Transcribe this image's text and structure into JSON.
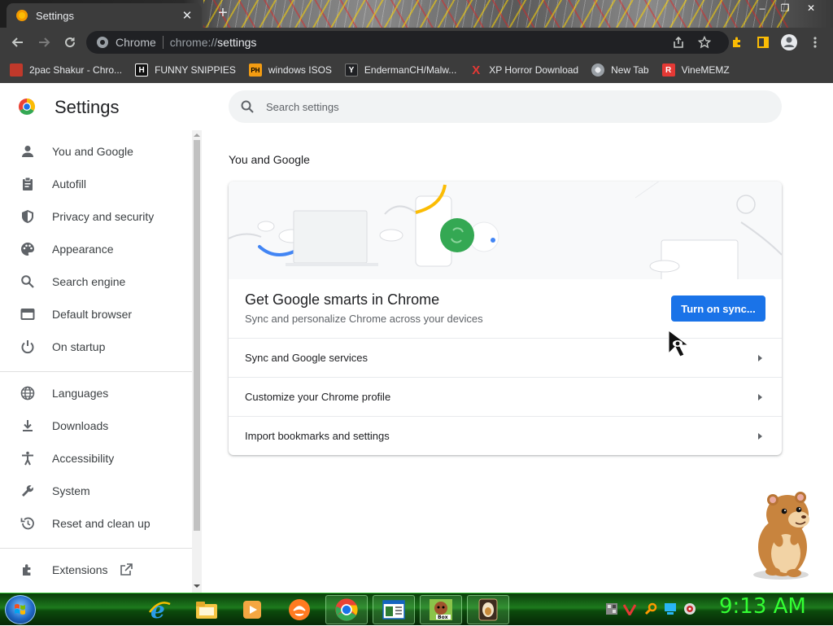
{
  "browser": {
    "tab_title": "Settings",
    "new_tab_symbol": "+",
    "tab_close_symbol": "✕",
    "window_controls": [
      "–",
      "❐",
      "✕"
    ],
    "omnibox": {
      "site_label": "Chrome",
      "url_scheme": "chrome://",
      "url_path": "settings"
    },
    "toolbar_icons": [
      "back-arrow-icon",
      "forward-arrow-icon",
      "reload-icon",
      "share-icon",
      "star-icon",
      "extensions-puzzle-icon",
      "side-panel-icon",
      "profile-icon",
      "more-vert-icon"
    ]
  },
  "bookmarks": [
    {
      "label": "2pac Shakur - Chro...",
      "icon_text": "",
      "icon_color": "#c0392b"
    },
    {
      "label": "FUNNY SNIPPIES",
      "icon_text": "H",
      "icon_color": "#ffffff"
    },
    {
      "label": "windows ISOS",
      "icon_text": "PH",
      "icon_color": "#f39c12"
    },
    {
      "label": "EndermanCH/Malw...",
      "icon_text": "Y",
      "icon_color": "#202124"
    },
    {
      "label": "XP Horror Download",
      "icon_text": "X",
      "icon_color": "#e53935"
    },
    {
      "label": "New Tab",
      "icon_text": "",
      "icon_color": "#9aa0a6"
    },
    {
      "label": "VineMEMZ",
      "icon_text": "R",
      "icon_color": "#e53935"
    }
  ],
  "settings": {
    "title": "Settings",
    "search_placeholder": "Search settings",
    "nav": [
      {
        "label": "You and Google",
        "icon": "person-icon"
      },
      {
        "label": "Autofill",
        "icon": "clipboard-icon"
      },
      {
        "label": "Privacy and security",
        "icon": "shield-icon"
      },
      {
        "label": "Appearance",
        "icon": "palette-icon"
      },
      {
        "label": "Search engine",
        "icon": "search-icon"
      },
      {
        "label": "Default browser",
        "icon": "browser-window-icon"
      },
      {
        "label": "On startup",
        "icon": "power-icon"
      },
      {
        "label": "Languages",
        "icon": "globe-icon"
      },
      {
        "label": "Downloads",
        "icon": "download-icon"
      },
      {
        "label": "Accessibility",
        "icon": "accessibility-icon"
      },
      {
        "label": "System",
        "icon": "wrench-icon"
      },
      {
        "label": "Reset and clean up",
        "icon": "history-icon"
      },
      {
        "label": "Extensions",
        "icon": "puzzle-icon"
      }
    ],
    "section_heading": "You and Google",
    "promo": {
      "title": "Get Google smarts in Chrome",
      "subtitle": "Sync and personalize Chrome across your devices",
      "button": "Turn on sync..."
    },
    "rows": [
      {
        "label": "Sync and Google services"
      },
      {
        "label": "Customize your Chrome profile"
      },
      {
        "label": "Import bookmarks and settings"
      }
    ]
  },
  "taskbar": {
    "clock": "9:13 AM",
    "apps": [
      "internet-explorer-icon",
      "file-explorer-icon",
      "media-player-icon",
      "uc-browser-icon",
      "chrome-icon",
      "document-viewer-icon",
      "bonzibuddy-box-icon",
      "egg-app-icon"
    ],
    "tray_icons": [
      "network-icon",
      "antivirus-v-icon",
      "search-tray-icon",
      "monitor-icon",
      "volume-icon"
    ]
  },
  "colors": {
    "accent": "#1a73e8",
    "toolbar": "#3c3c3c",
    "clock": "#33ff33",
    "taskbar": "#1d7a1d"
  }
}
